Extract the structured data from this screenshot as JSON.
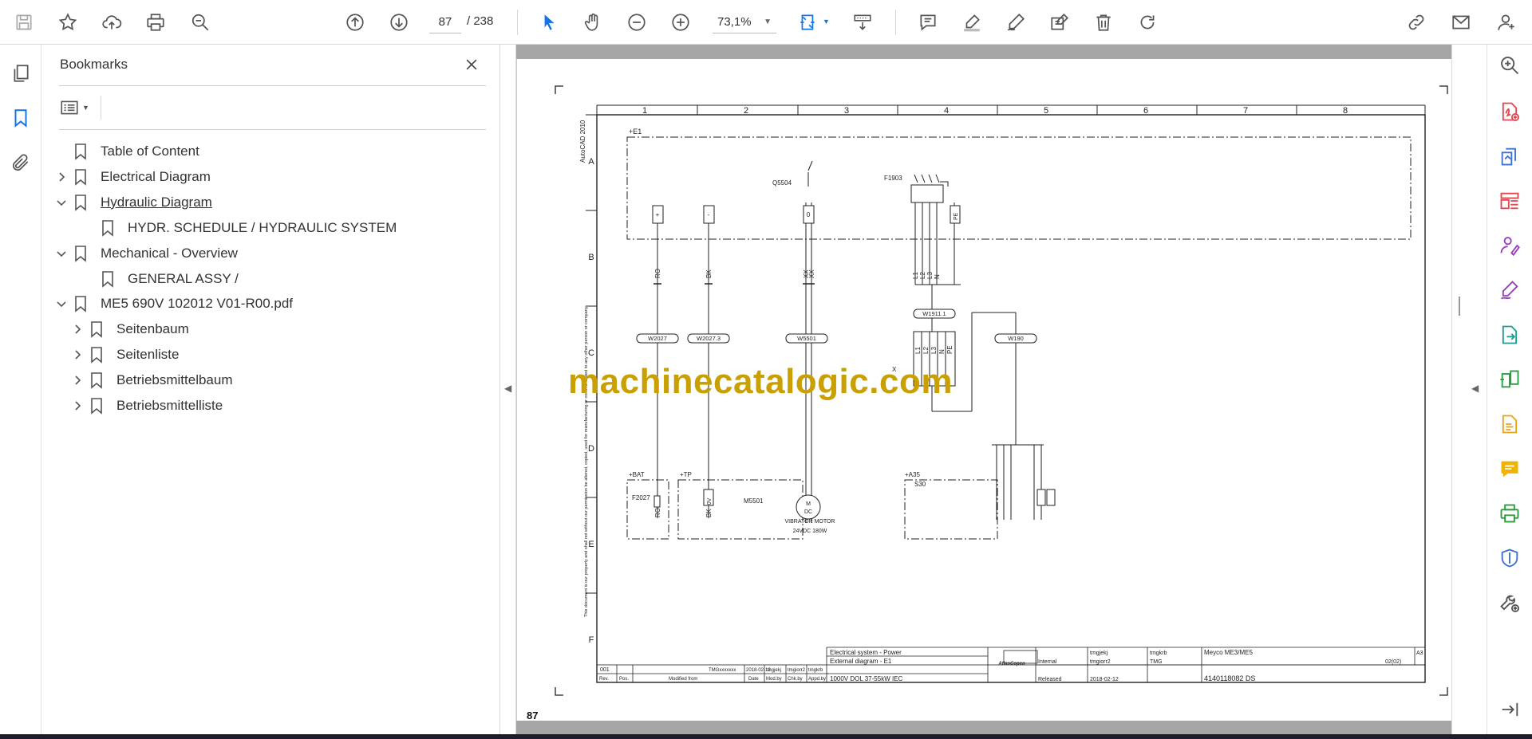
{
  "toolbar": {
    "page_current": "87",
    "page_total": "/  238",
    "zoom": "73,1%",
    "icons": [
      "save-icon",
      "star-icon",
      "cloud-upload-icon",
      "print-icon",
      "search-zoom-icon",
      "page-up-icon",
      "page-down-icon",
      "select-arrow-icon",
      "hand-icon",
      "zoom-out-icon",
      "zoom-in-icon",
      "fit-page-icon",
      "scroll-mode-icon",
      "comment-icon",
      "highlight-icon",
      "sign-icon",
      "edit-text-icon",
      "delete-icon",
      "rotate-icon",
      "link-icon",
      "mail-icon",
      "account-icon"
    ]
  },
  "panel": {
    "title": "Bookmarks",
    "bookmarks": [
      {
        "label": "Table of Content",
        "expand": "none",
        "current": false
      },
      {
        "label": "Electrical Diagram",
        "expand": "collapsed",
        "current": false
      },
      {
        "label": "Hydraulic Diagram",
        "expand": "expanded",
        "current": true
      },
      {
        "label": "HYDR. SCHEDULE / HYDRAULIC SYSTEM",
        "expand": "none",
        "current": false
      },
      {
        "label": "Mechanical - Overview",
        "expand": "expanded",
        "current": false
      },
      {
        "label": "GENERAL ASSY /",
        "expand": "none",
        "current": false
      },
      {
        "label": "ME5 690V 102012 V01-R00.pdf",
        "expand": "expanded",
        "current": false
      },
      {
        "label": "Seitenbaum",
        "expand": "collapsed",
        "current": false
      },
      {
        "label": "Seitenliste",
        "expand": "collapsed",
        "current": false
      },
      {
        "label": "Betriebsmittelbaum",
        "expand": "collapsed",
        "current": false
      },
      {
        "label": "Betriebsmittelliste",
        "expand": "collapsed",
        "current": false
      }
    ]
  },
  "document": {
    "watermark": "machinecatalogic.com",
    "page_number_label": "87",
    "column_numbers": [
      "1",
      "2",
      "3",
      "4",
      "5",
      "6",
      "7",
      "8"
    ],
    "row_letters": [
      "A",
      "B",
      "C",
      "D",
      "E",
      "F"
    ],
    "side_label": "AutoCAD 2010",
    "labels": {
      "e1": "+E1",
      "bat": "+BAT",
      "tp": "+TP",
      "a35": "+A35",
      "q5504": "Q5504",
      "f1903": "F1903",
      "f2027": "F2027",
      "m5501": "M5501",
      "motor_name": "VIBRATOR MOTOR",
      "motor_spec": "24VDC 180W",
      "s30": "S30",
      "w2027": "W2027",
      "w20273": "W2027.3",
      "w5501": "W5501",
      "w19111": "W1911.1",
      "w190": "W190",
      "x1": "X",
      "plus_sign": "+",
      "minus_sign": "-",
      "zero_sign": "0",
      "pe": "PE",
      "ro": "RO",
      "bk": "BK",
      "xx": "XX",
      "l1": "L1",
      "l2": "L2",
      "l3": "L3",
      "n": "N",
      "motor_m": "M",
      "motor_dc": "DC",
      "zero_v": "0V"
    },
    "title_block": {
      "rev": "001",
      "tmg": "TMGxxxxxxx",
      "date1": "2018-02-12",
      "tmg_a": "tmgjekj",
      "tmg_b": "tmgiorr2",
      "tmg_c": "tmgkrb",
      "col_rev": "Rev.",
      "col_pos": "Pos.",
      "col_modified": "Modified from",
      "col_date": "Date",
      "col_mod_by": "Mod.by",
      "col_chk_by": "Chk.by",
      "col_appd_by": "Appd.by",
      "line1": "Electrical system - Power",
      "line2": "External diagram - E1",
      "line3": "1000V DOL 37-55kW IEC",
      "brand": "AtlasCopco",
      "handling": "Internal",
      "status": "Released",
      "drawn": "tmgjekj",
      "resp": "tmgiorr2",
      "date2": "2018-02-12",
      "owner": "TMG",
      "approver": "tmgkrb",
      "product": "Meyco ME3/ME5",
      "size": "A3",
      "sheet": "02(02)",
      "doc_no": "4140118082  DS",
      "disclaimer": "This document is our property and shall not without our permission be altered, copied, used for manufacturing or communicated to any other person or company."
    }
  }
}
